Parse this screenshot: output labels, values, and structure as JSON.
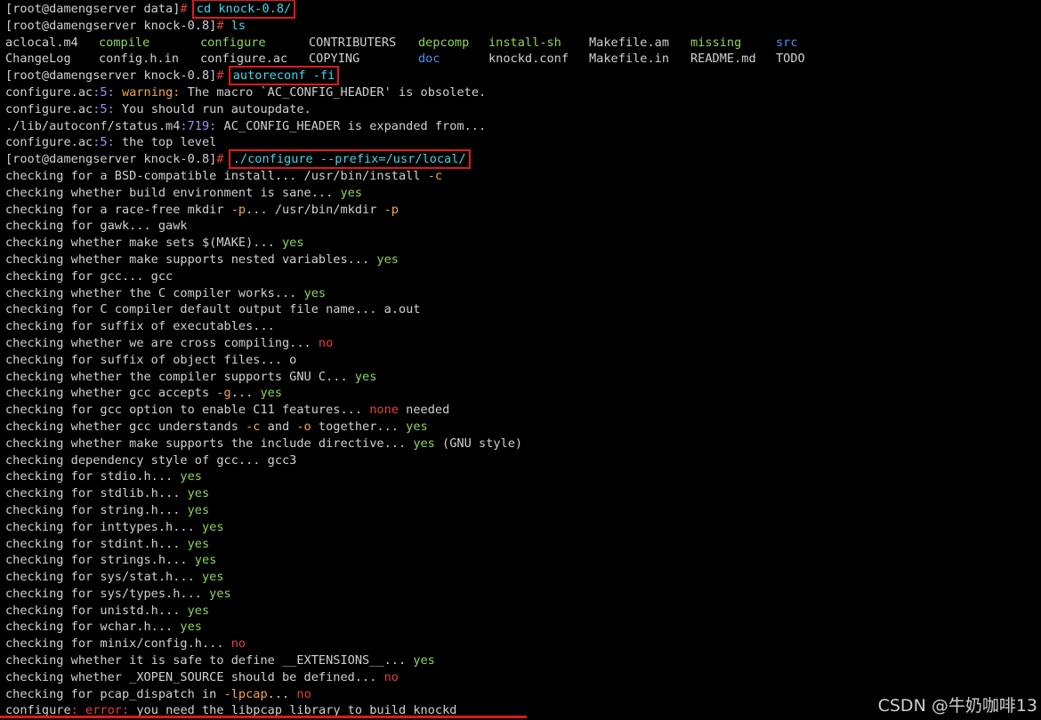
{
  "colors": {
    "background": "#000000",
    "text": "#d0d0d0",
    "yes": "#8ed45c",
    "no": "#e0413f",
    "option": "#f3a54a",
    "directory": "#4d8ef5",
    "number": "#a08ef5",
    "command": "#40d7e8",
    "highlight_box": "#e01a1a"
  },
  "lines": [
    [
      {
        "t": "[root@damengserver data]",
        "c": "plain"
      },
      {
        "t": "# ",
        "c": "red"
      },
      {
        "t": "cd knock-0.8/",
        "c": "cyan",
        "box": true
      }
    ],
    [
      {
        "t": "[root@damengserver knock-0.8]",
        "c": "plain"
      },
      {
        "t": "# ",
        "c": "red"
      },
      {
        "t": "ls",
        "c": "cyan"
      }
    ],
    {
      "cols": [
        {
          "t": "aclocal.m4",
          "c": "plain"
        },
        {
          "t": "compile",
          "c": "green"
        },
        {
          "t": "configure",
          "c": "green"
        },
        {
          "t": "CONTRIBUTERS",
          "c": "plain"
        },
        {
          "t": "depcomp",
          "c": "green"
        },
        {
          "t": "install-sh",
          "c": "green"
        },
        {
          "t": "Makefile.am",
          "c": "plain"
        },
        {
          "t": "missing",
          "c": "green"
        },
        {
          "t": "src",
          "c": "blue"
        }
      ]
    },
    {
      "cols": [
        {
          "t": "ChangeLog",
          "c": "plain"
        },
        {
          "t": "config.h.in",
          "c": "plain"
        },
        {
          "t": "configure.ac",
          "c": "plain"
        },
        {
          "t": "COPYING",
          "c": "plain"
        },
        {
          "t": "doc",
          "c": "blue"
        },
        {
          "t": "knockd.conf",
          "c": "plain"
        },
        {
          "t": "Makefile.in",
          "c": "plain"
        },
        {
          "t": "README.md",
          "c": "plain"
        },
        {
          "t": "TODO",
          "c": "plain"
        }
      ]
    },
    [
      {
        "t": "[root@damengserver knock-0.8]",
        "c": "plain"
      },
      {
        "t": "# ",
        "c": "red"
      },
      {
        "t": "autoreconf -fi",
        "c": "cyan",
        "box": true
      }
    ],
    [
      {
        "t": "configure.ac",
        "c": "plain"
      },
      {
        "t": ":5: ",
        "c": "purple"
      },
      {
        "t": "warning: ",
        "c": "orange"
      },
      {
        "t": "The macro `AC_CONFIG_HEADER' is obsolete.",
        "c": "plain"
      }
    ],
    [
      {
        "t": "configure.ac",
        "c": "plain"
      },
      {
        "t": ":5: ",
        "c": "purple"
      },
      {
        "t": "You should run autoupdate.",
        "c": "plain"
      }
    ],
    [
      {
        "t": "./lib/autoconf/status.m4",
        "c": "plain"
      },
      {
        "t": ":719: ",
        "c": "purple"
      },
      {
        "t": "AC_CONFIG_HEADER is expanded from...",
        "c": "plain"
      }
    ],
    [
      {
        "t": "configure.ac",
        "c": "plain"
      },
      {
        "t": ":5: ",
        "c": "purple"
      },
      {
        "t": "the top level",
        "c": "plain"
      }
    ],
    [
      {
        "t": "[root@damengserver knock-0.8]",
        "c": "plain"
      },
      {
        "t": "# ",
        "c": "red"
      },
      {
        "t": "./configure --prefix=/usr/local/",
        "c": "cyan",
        "box": true
      }
    ],
    [
      {
        "t": "checking for a BSD-compatible install... /usr/bin/install ",
        "c": "plain"
      },
      {
        "t": "-c",
        "c": "orange"
      }
    ],
    [
      {
        "t": "checking whether build environment is sane... ",
        "c": "plain"
      },
      {
        "t": "yes",
        "c": "green"
      }
    ],
    [
      {
        "t": "checking for a race-free mkdir ",
        "c": "plain"
      },
      {
        "t": "-p",
        "c": "orange"
      },
      {
        "t": "... /usr/bin/mkdir ",
        "c": "plain"
      },
      {
        "t": "-p",
        "c": "orange"
      }
    ],
    [
      {
        "t": "checking for gawk... gawk",
        "c": "plain"
      }
    ],
    [
      {
        "t": "checking whether make sets $(MAKE)... ",
        "c": "plain"
      },
      {
        "t": "yes",
        "c": "green"
      }
    ],
    [
      {
        "t": "checking whether make supports nested variables... ",
        "c": "plain"
      },
      {
        "t": "yes",
        "c": "green"
      }
    ],
    [
      {
        "t": "checking for gcc... gcc",
        "c": "plain"
      }
    ],
    [
      {
        "t": "checking whether the C compiler works... ",
        "c": "plain"
      },
      {
        "t": "yes",
        "c": "green"
      }
    ],
    [
      {
        "t": "checking for C compiler default output file name... a.out",
        "c": "plain"
      }
    ],
    [
      {
        "t": "checking for suffix of executables...",
        "c": "plain"
      }
    ],
    [
      {
        "t": "checking whether we are cross compiling... ",
        "c": "plain"
      },
      {
        "t": "no",
        "c": "red"
      }
    ],
    [
      {
        "t": "checking for suffix of object files... o",
        "c": "plain"
      }
    ],
    [
      {
        "t": "checking whether the compiler supports GNU C... ",
        "c": "plain"
      },
      {
        "t": "yes",
        "c": "green"
      }
    ],
    [
      {
        "t": "checking whether gcc accepts ",
        "c": "plain"
      },
      {
        "t": "-g",
        "c": "orange"
      },
      {
        "t": "... ",
        "c": "plain"
      },
      {
        "t": "yes",
        "c": "green"
      }
    ],
    [
      {
        "t": "checking for gcc option to enable C11 features... ",
        "c": "plain"
      },
      {
        "t": "none",
        "c": "red"
      },
      {
        "t": " needed",
        "c": "plain"
      }
    ],
    [
      {
        "t": "checking whether gcc understands ",
        "c": "plain"
      },
      {
        "t": "-c",
        "c": "orange"
      },
      {
        "t": " and ",
        "c": "plain"
      },
      {
        "t": "-o",
        "c": "orange"
      },
      {
        "t": " together... ",
        "c": "plain"
      },
      {
        "t": "yes",
        "c": "green"
      }
    ],
    [
      {
        "t": "checking whether make supports the include directive... ",
        "c": "plain"
      },
      {
        "t": "yes",
        "c": "green"
      },
      {
        "t": " (GNU style)",
        "c": "plain"
      }
    ],
    [
      {
        "t": "checking dependency style of gcc... gcc3",
        "c": "plain"
      }
    ],
    [
      {
        "t": "checking for stdio.h... ",
        "c": "plain"
      },
      {
        "t": "yes",
        "c": "green"
      }
    ],
    [
      {
        "t": "checking for stdlib.h... ",
        "c": "plain"
      },
      {
        "t": "yes",
        "c": "green"
      }
    ],
    [
      {
        "t": "checking for string.h... ",
        "c": "plain"
      },
      {
        "t": "yes",
        "c": "green"
      }
    ],
    [
      {
        "t": "checking for inttypes.h... ",
        "c": "plain"
      },
      {
        "t": "yes",
        "c": "green"
      }
    ],
    [
      {
        "t": "checking for stdint.h... ",
        "c": "plain"
      },
      {
        "t": "yes",
        "c": "green"
      }
    ],
    [
      {
        "t": "checking for strings.h... ",
        "c": "plain"
      },
      {
        "t": "yes",
        "c": "green"
      }
    ],
    [
      {
        "t": "checking for sys/stat.h... ",
        "c": "plain"
      },
      {
        "t": "yes",
        "c": "green"
      }
    ],
    [
      {
        "t": "checking for sys/types.h... ",
        "c": "plain"
      },
      {
        "t": "yes",
        "c": "green"
      }
    ],
    [
      {
        "t": "checking for unistd.h... ",
        "c": "plain"
      },
      {
        "t": "yes",
        "c": "green"
      }
    ],
    [
      {
        "t": "checking for wchar.h... ",
        "c": "plain"
      },
      {
        "t": "yes",
        "c": "green"
      }
    ],
    [
      {
        "t": "checking for minix/config.h... ",
        "c": "plain"
      },
      {
        "t": "no",
        "c": "red"
      }
    ],
    [
      {
        "t": "checking whether it is safe to define __EXTENSIONS__... ",
        "c": "plain"
      },
      {
        "t": "yes",
        "c": "green"
      }
    ],
    [
      {
        "t": "checking whether _XOPEN_SOURCE should be defined... ",
        "c": "plain"
      },
      {
        "t": "no",
        "c": "red"
      }
    ],
    [
      {
        "t": "checking for pcap_dispatch in ",
        "c": "plain"
      },
      {
        "t": "-lpcap",
        "c": "orange"
      },
      {
        "t": "... ",
        "c": "plain"
      },
      {
        "t": "no",
        "c": "red"
      }
    ],
    [
      {
        "t": "configure",
        "c": "plain"
      },
      {
        "t": ": ",
        "c": "red"
      },
      {
        "t": "error: ",
        "c": "red"
      },
      {
        "t": "you need the libpcap library to build knockd",
        "c": "plain"
      }
    ]
  ],
  "watermark": "CSDN @牛奶咖啡13"
}
